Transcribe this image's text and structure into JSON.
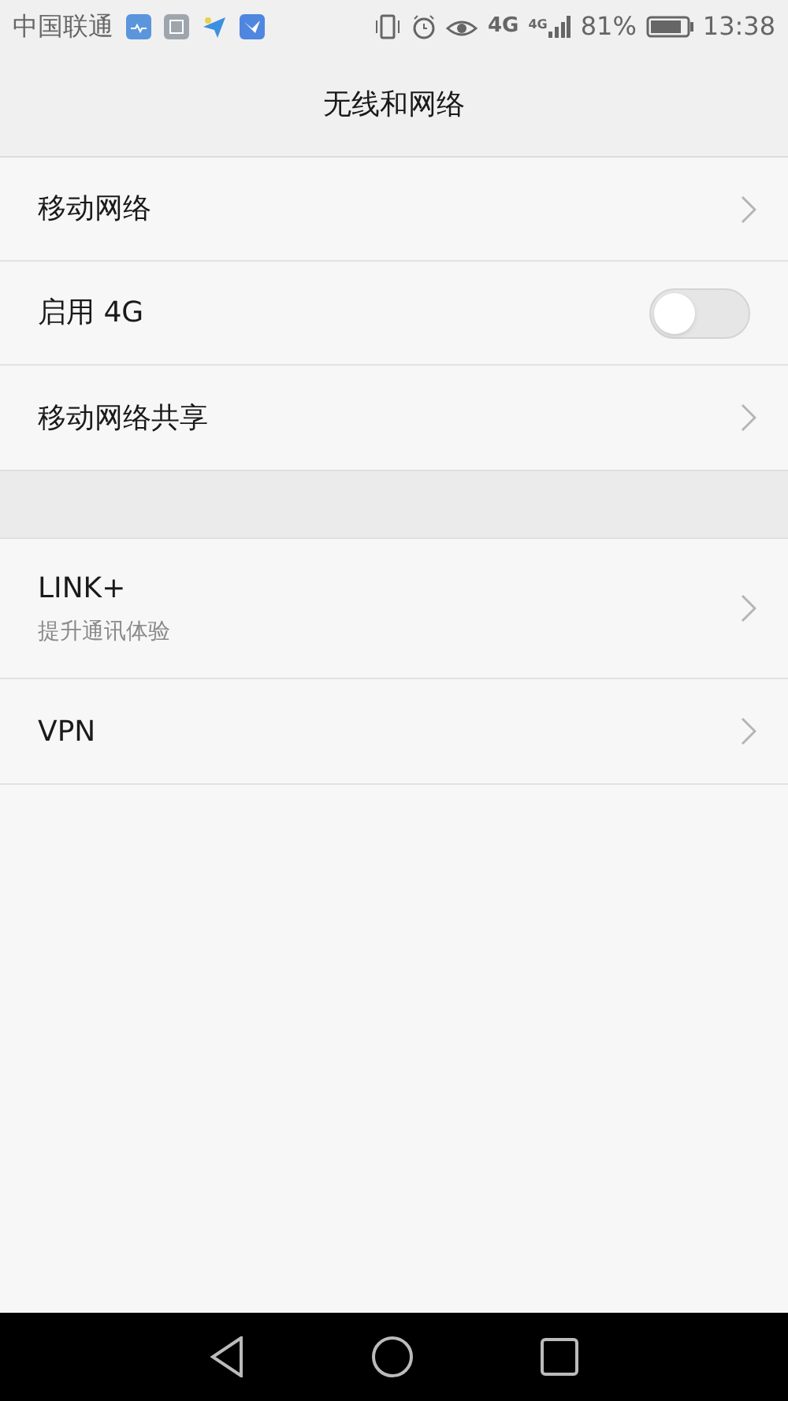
{
  "status_bar": {
    "carrier": "中国联通",
    "network_type": "4G",
    "signal_label": "4G",
    "battery": "81%",
    "time": "13:38"
  },
  "header": {
    "title": "无线和网络"
  },
  "groups": [
    {
      "items": [
        {
          "kind": "link",
          "label": "移动网络"
        },
        {
          "kind": "toggle",
          "label": "启用 4G",
          "on": false
        },
        {
          "kind": "link",
          "label": "移动网络共享"
        }
      ]
    },
    {
      "items": [
        {
          "kind": "link",
          "label": "LINK+",
          "subtitle": "提升通讯体验"
        },
        {
          "kind": "link",
          "label": "VPN"
        }
      ]
    }
  ]
}
